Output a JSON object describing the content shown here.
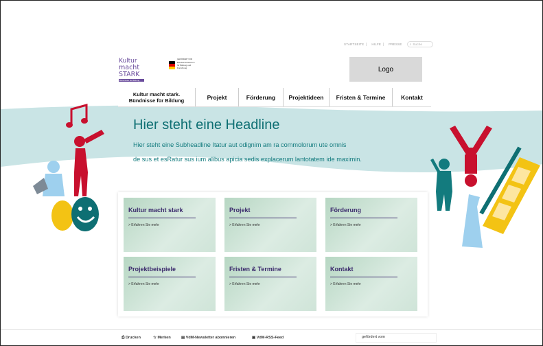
{
  "top_links": [
    "STARTSEITE",
    "HILFE",
    "PRESSE"
  ],
  "search": {
    "placeholder": "Suche"
  },
  "logo_placeholder": "Logo",
  "brand": {
    "line1": "Kultur",
    "line2": "macht STARK",
    "tagline": "Bündnisse für Bildung"
  },
  "sponsor": {
    "small": "GEFÖRDERT VOM",
    "name": "Bundesministerium für Bildung und Forschung"
  },
  "nav": [
    "Kultur macht stark. Bündnisse für Bildung",
    "Projekt",
    "Förderung",
    "Projektideen",
    "Fristen & Termine",
    "Kontakt"
  ],
  "hero": {
    "headline": "Hier steht eine Headline",
    "sub1": "Hier steht eine Subheadline Itatur aut odignim am ra commolorum ute omnis",
    "sub2": "de sus et esRatur sus ium alibus apicia sedis explacerum lantotatem ide maximin."
  },
  "tiles": [
    {
      "title": "Kultur macht stark",
      "more": "> Erfahren Sie mehr"
    },
    {
      "title": "Projekt",
      "more": "> Erfahren Sie mehr"
    },
    {
      "title": "Förderung",
      "more": "> Erfahren Sie mehr"
    },
    {
      "title": "Projektbeispiele",
      "more": "> Erfahren Sie mehr"
    },
    {
      "title": "Fristen & Termine",
      "more": "> Erfahren Sie mehr"
    },
    {
      "title": "Kontakt",
      "more": "> Erfahren Sie mehr"
    }
  ],
  "footer": {
    "links": [
      "Drucken",
      "Merken",
      "VdM-Newsletter abonnieren",
      "VdM-RSS-Feed"
    ],
    "gefoerdert": "gefördert vom"
  },
  "colors": {
    "teal": "#0e6f73",
    "purple": "#3b2a6c",
    "wave": "#c9e4e5"
  }
}
